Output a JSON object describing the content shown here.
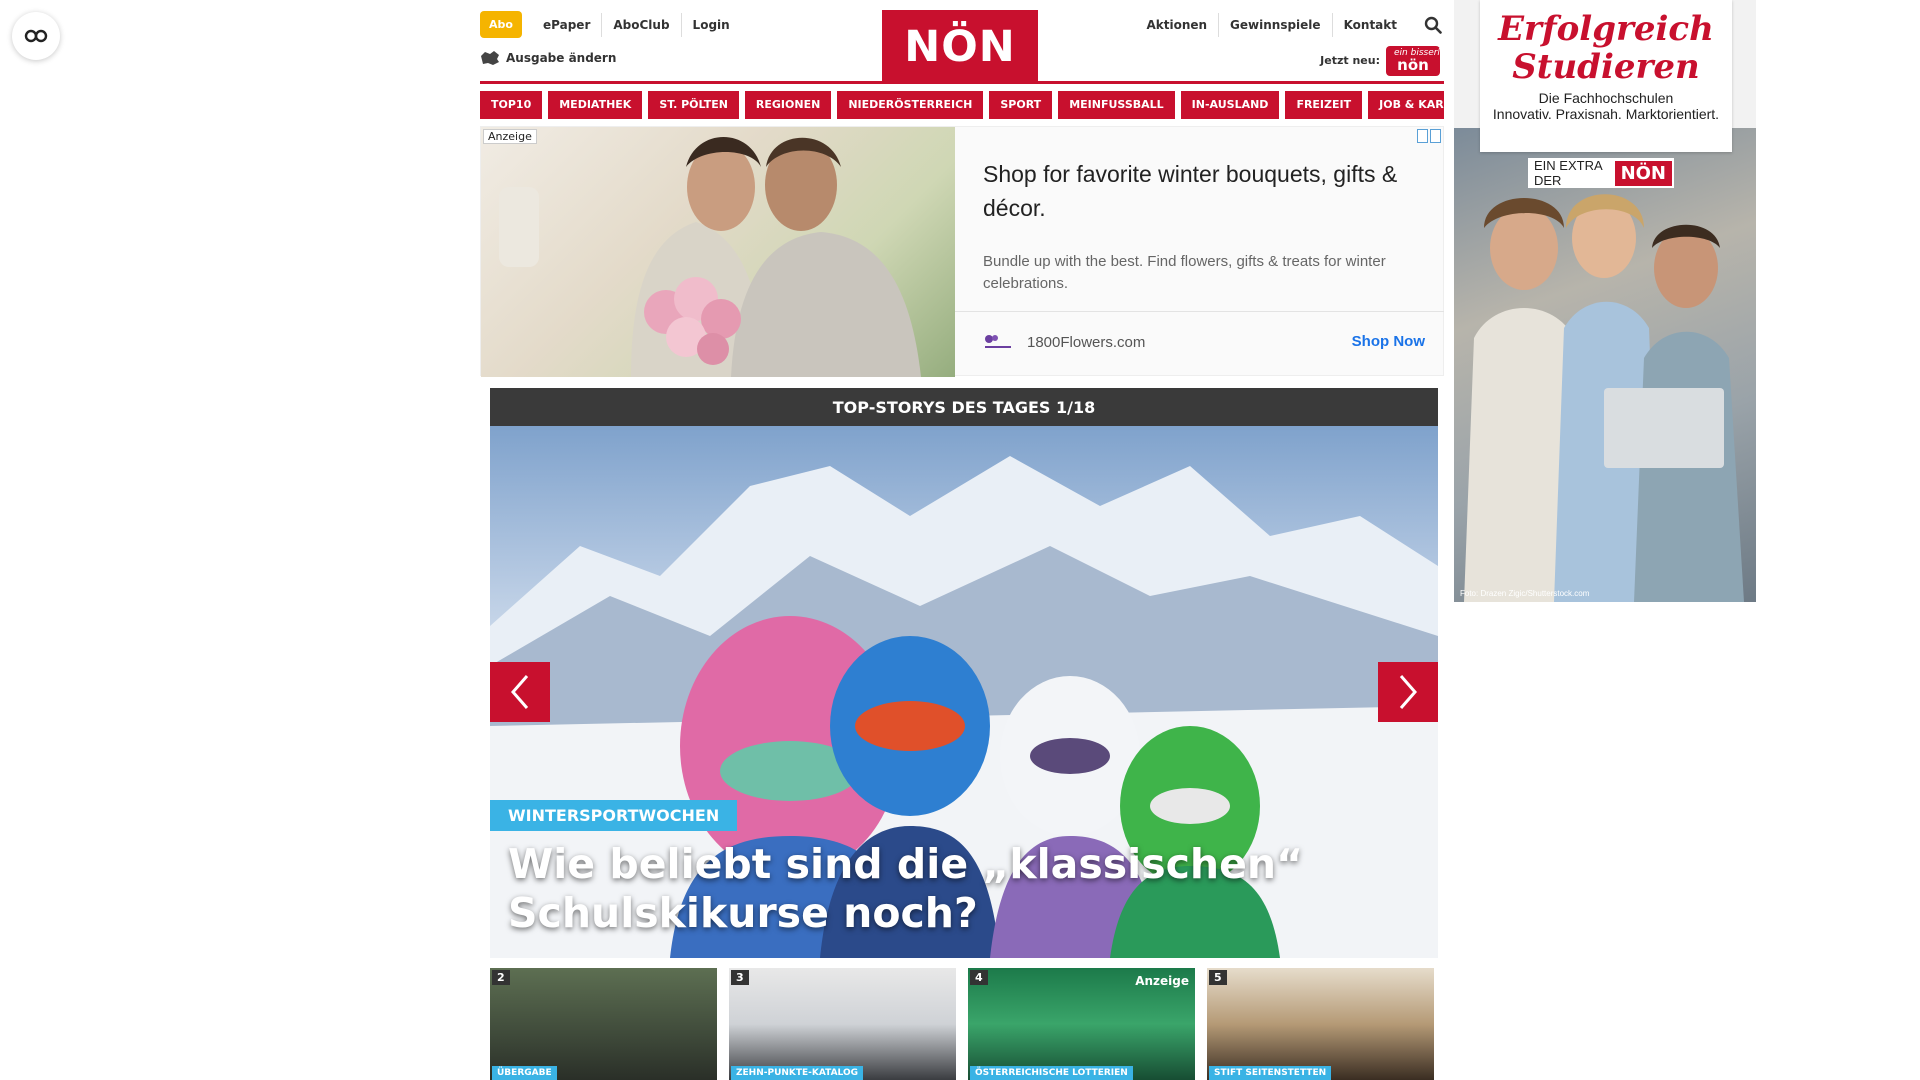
{
  "header": {
    "abo": "Abo",
    "left_links": [
      "ePaper",
      "AboClub",
      "Login"
    ],
    "right_links": [
      "Aktionen",
      "Gewinnspiele",
      "Kontakt"
    ],
    "logo": "NÖN",
    "edition": "Ausgabe ändern",
    "jetzt_neu": "Jetzt neu:",
    "jetzt_badge_small": "ein bisserl",
    "jetzt_badge": "nön"
  },
  "nav": [
    "TOP10",
    "MEDIATHEK",
    "ST. PÖLTEN",
    "REGIONEN",
    "NIEDERÖSTERREICH",
    "SPORT",
    "MEINFUSSBALL",
    "IN-AUSLAND",
    "FREIZEIT",
    "JOB & KARRIERE"
  ],
  "ad": {
    "label": "Anzeige",
    "title": "Shop for favorite winter bouquets, gifts & décor.",
    "description": "Bundle up with the best. Find flowers, gifts & treats for winter celebrations.",
    "brand": "1800Flowers.com",
    "cta": "Shop Now"
  },
  "stories": {
    "heading": "TOP-STORYS DES TAGES 1/18",
    "hero_tag": "WINTERSPORTWOCHEN",
    "hero_title": "Wie beliebt sind die „klassischen“ Schulskikurse noch?",
    "thumbs": [
      {
        "num": "2",
        "tag": "ÜBERGABE",
        "ad": ""
      },
      {
        "num": "3",
        "tag": "ZEHN-PUNKTE-KATALOG",
        "ad": ""
      },
      {
        "num": "4",
        "tag": "ÖSTERREICHISCHE LOTTERIEN",
        "ad": "Anzeige"
      },
      {
        "num": "5",
        "tag": "STIFT SEITENSTETTEN",
        "ad": ""
      }
    ]
  },
  "side_ad": {
    "headline_1": "Erfolgreich",
    "headline_2": "Studieren",
    "sub_1": "Die Fachhochschulen",
    "sub_2": "Innovativ. Praxisnah. Marktorientiert.",
    "extra_label": "EIN EXTRA DER",
    "extra_logo": "NÖN",
    "photo_credit": "Foto: Drazen Zigic/Shutterstock.com"
  },
  "colors": {
    "brand_red": "#c8102e",
    "abo_yellow": "#f5b400",
    "tag_blue": "#3ab3e5",
    "cta_blue": "#1a73e8"
  }
}
